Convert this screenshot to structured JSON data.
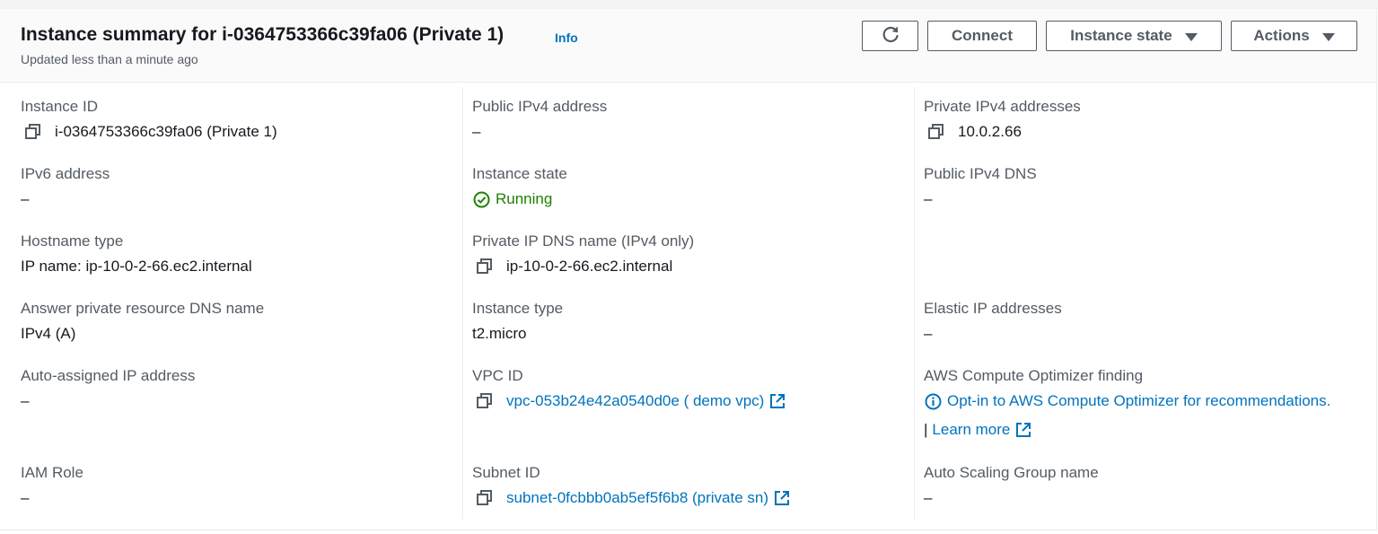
{
  "header": {
    "title": "Instance summary for i-0364753366c39fa06 (Private 1)",
    "info_label": "Info",
    "subtitle": "Updated less than a minute ago",
    "buttons": {
      "refresh_icon": "refresh-icon",
      "connect": "Connect",
      "instance_state": "Instance state",
      "actions": "Actions"
    }
  },
  "fields": {
    "instance_id": {
      "label": "Instance ID",
      "value": "i-0364753366c39fa06 (Private 1)"
    },
    "public_ipv4": {
      "label": "Public IPv4 address",
      "value": "–"
    },
    "private_ipv4": {
      "label": "Private IPv4 addresses",
      "value": "10.0.2.66"
    },
    "ipv6": {
      "label": "IPv6 address",
      "value": "–"
    },
    "instance_state": {
      "label": "Instance state",
      "value": "Running"
    },
    "public_dns": {
      "label": "Public IPv4 DNS",
      "value": "–"
    },
    "hostname_type": {
      "label": "Hostname type",
      "value": "IP name: ip-10-0-2-66.ec2.internal"
    },
    "private_dns": {
      "label": "Private IP DNS name (IPv4 only)",
      "value": "ip-10-0-2-66.ec2.internal"
    },
    "answer_dns": {
      "label": "Answer private resource DNS name",
      "value": "IPv4 (A)"
    },
    "instance_type": {
      "label": "Instance type",
      "value": "t2.micro"
    },
    "elastic_ip": {
      "label": "Elastic IP addresses",
      "value": "–"
    },
    "auto_ip": {
      "label": "Auto-assigned IP address",
      "value": "–"
    },
    "vpc_id": {
      "label": "VPC ID",
      "value": "vpc-053b24e42a0540d0e ( demo vpc)"
    },
    "optimizer": {
      "label": "AWS Compute Optimizer finding",
      "value": "Opt-in to AWS Compute Optimizer for recommendations.",
      "separator": "|",
      "learn_more": "Learn more"
    },
    "iam_role": {
      "label": "IAM Role",
      "value": "–"
    },
    "subnet_id": {
      "label": "Subnet ID",
      "value": "subnet-0fcbbb0ab5ef5f6b8 (private sn)"
    },
    "asg_name": {
      "label": "Auto Scaling Group name",
      "value": "–"
    }
  },
  "colors": {
    "link": "#0073bb",
    "running": "#1d8102",
    "label": "#545b64",
    "text": "#16191f"
  }
}
